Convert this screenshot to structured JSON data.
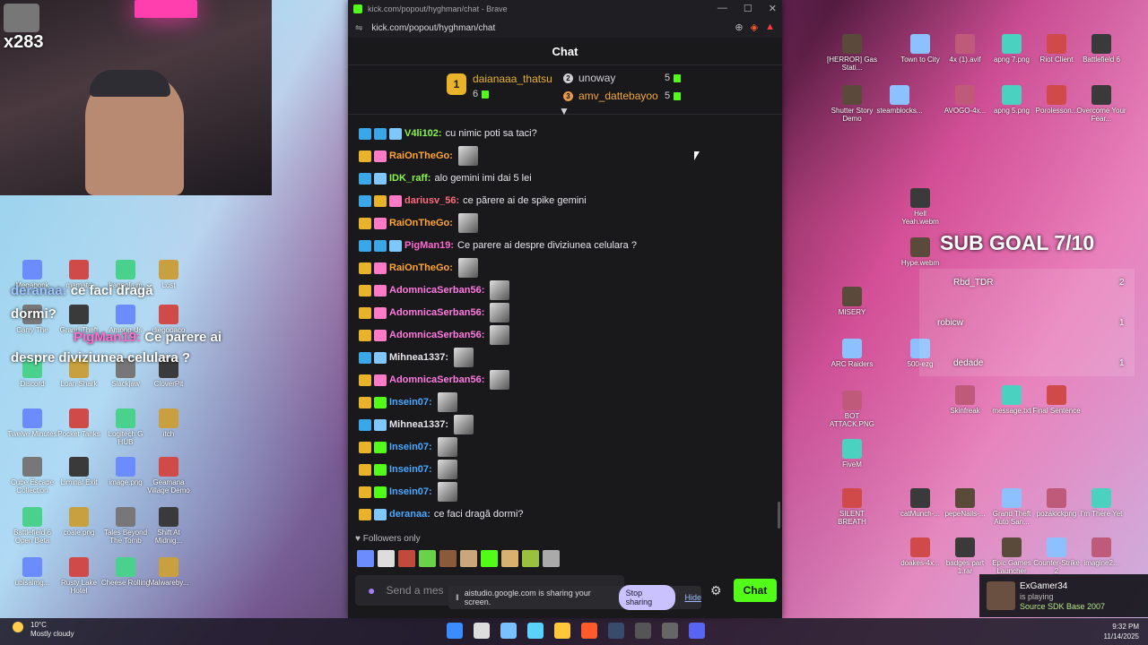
{
  "webcam": {
    "viewer_count": "x283"
  },
  "overlay": {
    "line1_user": "deranaa:",
    "line1_text": "ce faci dragă",
    "line2_text": "dormi?",
    "line3_user": "PigMan19:",
    "line3_text": "Ce parere ai",
    "line4_text": "despre diviziunea celulara ?"
  },
  "sub_goal": {
    "title": "SUB GOAL 7/10",
    "items": [
      {
        "name": "Rbd_TDR",
        "count": "2"
      },
      {
        "name": "robicw",
        "count": "1"
      },
      {
        "name": "dedade",
        "count": "1"
      }
    ]
  },
  "desktop_icons_left": [
    "Megabonk",
    "mamata",
    "bagpola.m",
    "Lost",
    "Carry The",
    "Grand Theft",
    "Among Us",
    "diegopaco",
    "Discord",
    "Loan Shark",
    "Slackjaw",
    "CloverPit",
    "Twelve Minutes",
    "Pocket Tanks",
    "Logitech G HUB",
    "itch",
    "Cube Escape Collection",
    "Liminal Exit",
    "image.png",
    "Geamana Village Demo",
    "Battlefield 6 Open Beta",
    "coaie.png",
    "Tales Beyond The Tomb",
    "Shift At Midnig...",
    "ubisaimg...",
    "Rusty Lake Hotel",
    "Cheese Rolling",
    "Malwareby..."
  ],
  "desktop_icons_right": [
    "[HERROR] Gas Stati...",
    "Town to City",
    "4x (1).avif",
    "apng 7.png",
    "Riot Client",
    "Battlefield 6",
    "Shutter Story Demo",
    "steamblocks...",
    "AVOGO-4x...",
    "apng 5.png",
    "Porolesson...",
    "Overcome Your Fear...",
    "MISERY",
    "ARC Raiders",
    "BOT ATTACK.PNG",
    "FiveM",
    "SILENT BREATH",
    "Hell Yeah.webm",
    "Hype.webm",
    "500-ezg",
    "Skinfreak",
    "message.txt",
    "Final Sentence",
    "catMunch-...",
    "pepeNails-...",
    "Grand Theft Auto San...",
    "pozakickpng",
    "I'm There Yet",
    "doakes-4x...",
    "badges part 1.rar",
    "Epic Games Launcher",
    "Counter-Strike 2",
    "imagine2..."
  ],
  "browser": {
    "title": "kick.com/popout/hyghman/chat - Brave",
    "url": "kick.com/popout/hyghman/chat"
  },
  "chat": {
    "header": "Chat",
    "leaderboard": [
      {
        "rank": "1",
        "name": "daianaaa_thatsu",
        "count": "6"
      },
      {
        "rank": "2",
        "name": "unoway",
        "count": "5"
      },
      {
        "rank": "3",
        "name": "amv_dattebayoo",
        "count": "5"
      }
    ],
    "messages": [
      {
        "user": "V4li102:",
        "color": "#8cf54a",
        "text": "cu nimic poti sa taci?",
        "badges": [
          "b-blue",
          "b-blue",
          "b-bot"
        ],
        "emote": false
      },
      {
        "user": "RaiOnTheGo:",
        "color": "#ffa531",
        "text": "",
        "badges": [
          "b-crown",
          "b-pink"
        ],
        "emote": true
      },
      {
        "user": "IDK_raff:",
        "color": "#8cf54a",
        "text": "alo gemini imi dai 5 lei",
        "badges": [
          "b-blue",
          "b-bot"
        ],
        "emote": false
      },
      {
        "user": "dariusv_56:",
        "color": "#ff6a7c",
        "text": "ce părere ai de spike gemini",
        "badges": [
          "b-blue",
          "b-crown",
          "b-pink"
        ],
        "emote": false
      },
      {
        "user": "RaiOnTheGo:",
        "color": "#ffa531",
        "text": "",
        "badges": [
          "b-crown",
          "b-pink"
        ],
        "emote": true
      },
      {
        "user": "PigMan19:",
        "color": "#ff6ad1",
        "text": "Ce parere ai despre diviziunea celulara ?",
        "badges": [
          "b-blue",
          "b-blue",
          "b-bot"
        ],
        "emote": false
      },
      {
        "user": "RaiOnTheGo:",
        "color": "#ffa531",
        "text": "",
        "badges": [
          "b-crown",
          "b-pink"
        ],
        "emote": true
      },
      {
        "user": "AdomnicaSerban56:",
        "color": "#ff7ae0",
        "text": "",
        "badges": [
          "b-crown",
          "b-pink"
        ],
        "emote": true
      },
      {
        "user": "AdomnicaSerban56:",
        "color": "#ff7ae0",
        "text": "",
        "badges": [
          "b-crown",
          "b-pink"
        ],
        "emote": true
      },
      {
        "user": "AdomnicaSerban56:",
        "color": "#ff7ae0",
        "text": "",
        "badges": [
          "b-crown",
          "b-pink"
        ],
        "emote": true
      },
      {
        "user": "Mihnea1337:",
        "color": "#e6e6ea",
        "text": "",
        "badges": [
          "b-blue",
          "b-bot"
        ],
        "emote": true
      },
      {
        "user": "AdomnicaSerban56:",
        "color": "#ff7ae0",
        "text": "",
        "badges": [
          "b-crown",
          "b-pink"
        ],
        "emote": true
      },
      {
        "user": "Insein07:",
        "color": "#4aa8ff",
        "text": "",
        "badges": [
          "b-crown",
          "b-green"
        ],
        "emote": true
      },
      {
        "user": "Mihnea1337:",
        "color": "#e6e6ea",
        "text": "",
        "badges": [
          "b-blue",
          "b-bot"
        ],
        "emote": true
      },
      {
        "user": "Insein07:",
        "color": "#4aa8ff",
        "text": "",
        "badges": [
          "b-crown",
          "b-green"
        ],
        "emote": true
      },
      {
        "user": "Insein07:",
        "color": "#4aa8ff",
        "text": "",
        "badges": [
          "b-crown",
          "b-green"
        ],
        "emote": true
      },
      {
        "user": "Insein07:",
        "color": "#4aa8ff",
        "text": "",
        "badges": [
          "b-crown",
          "b-green"
        ],
        "emote": true
      },
      {
        "user": "deranaa:",
        "color": "#4aa8ff",
        "text": "ce faci dragă dormi?",
        "badges": [
          "b-crown",
          "b-bot"
        ],
        "emote": false
      }
    ],
    "followers_only": "Followers only",
    "input_placeholder": "Send a mes",
    "send_label": "Chat"
  },
  "screen_share": {
    "text": "aistudio.google.com is sharing your screen.",
    "stop_label": "Stop sharing",
    "hide_label": "Hide"
  },
  "notification": {
    "user": "ExGamer34",
    "status": "is playing",
    "game": "Source SDK Base 2007"
  },
  "taskbar": {
    "temperature": "10°C",
    "weather": "Mostly cloudy",
    "time": "9:32 PM",
    "date": "11/14/2025"
  }
}
